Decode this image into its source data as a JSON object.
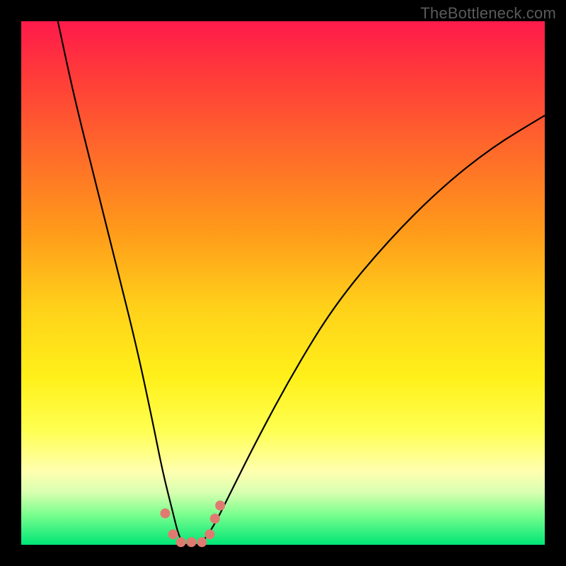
{
  "watermark": "TheBottleneck.com",
  "chart_data": {
    "type": "line",
    "title": "",
    "xlabel": "",
    "ylabel": "",
    "xlim": [
      0,
      100
    ],
    "ylim": [
      0,
      100
    ],
    "series": [
      {
        "name": "bottleneck-curve",
        "x": [
          7,
          10,
          14,
          18,
          22,
          25,
          27,
          29,
          30,
          31,
          32,
          33,
          34,
          35,
          37,
          40,
          45,
          52,
          60,
          70,
          80,
          90,
          100
        ],
        "values": [
          100,
          86,
          70,
          54,
          38,
          24,
          14,
          6,
          2,
          0,
          0,
          0,
          0,
          1,
          4,
          10,
          20,
          33,
          46,
          58,
          68,
          76,
          82
        ]
      }
    ],
    "bottom_dots": {
      "name": "dots",
      "points": [
        {
          "x": 27.5,
          "y": 6
        },
        {
          "x": 29.0,
          "y": 2
        },
        {
          "x": 30.5,
          "y": 0.5
        },
        {
          "x": 32.5,
          "y": 0.5
        },
        {
          "x": 34.5,
          "y": 0.5
        },
        {
          "x": 36.0,
          "y": 2
        },
        {
          "x": 37.0,
          "y": 5
        },
        {
          "x": 38.0,
          "y": 7.5
        }
      ]
    }
  }
}
